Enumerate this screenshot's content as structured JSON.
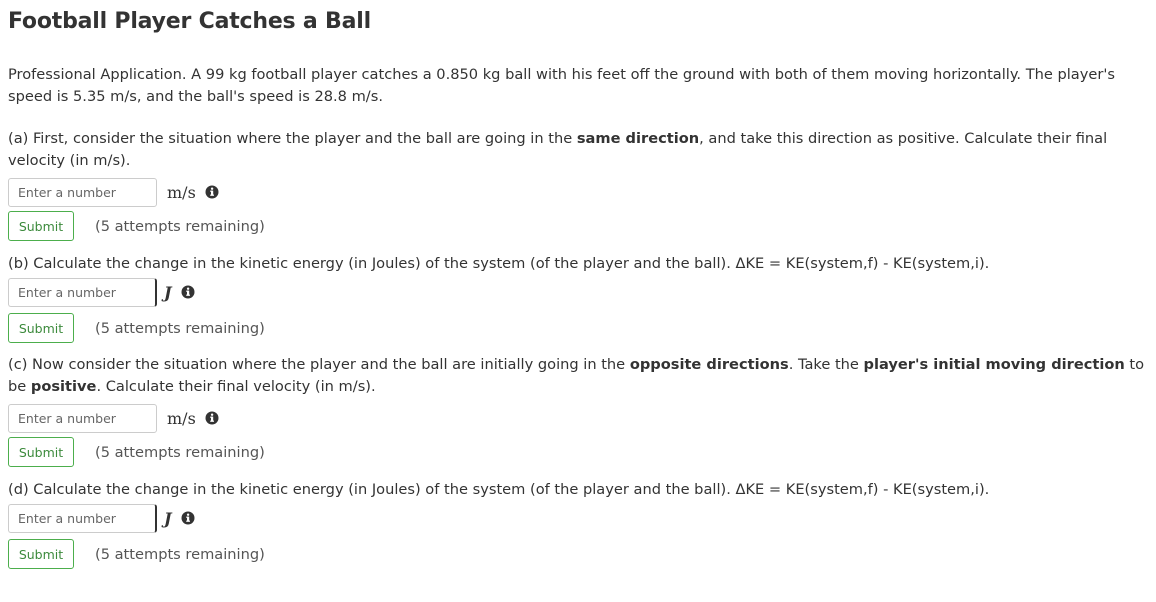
{
  "title": "Football Player Catches a Ball",
  "intro": "Professional Application. A 99 kg football player catches a 0.850 kg ball with his feet off the ground with both of them moving horizontally. The player's speed is 5.35 m/s, and the ball's speed is 28.8 m/s.",
  "parts": [
    {
      "text_segments": [
        "(a) First, consider the situation where the player and the ball are going in the ",
        "same direction",
        ", and take this direction as positive. Calculate their final velocity (in m/s)."
      ],
      "placeholder": "Enter a number",
      "unit": "m/s",
      "submit_label": "Submit",
      "attempts": "(5 attempts remaining)"
    },
    {
      "text": "(b) Calculate the change in the kinetic energy (in Joules) of the system (of the player and the ball). ΔKE = KE(system,f) - KE(system,i).",
      "placeholder": "Enter a number",
      "unit": "J",
      "submit_label": "Submit",
      "attempts": "(5 attempts remaining)"
    },
    {
      "text_segments": [
        "(c) Now consider the situation where the player and the ball are initially going in the ",
        "opposite directions",
        ". Take the ",
        "player's initial moving direction",
        " to be ",
        "positive",
        ". Calculate their final velocity (in m/s)."
      ],
      "placeholder": "Enter a number",
      "unit": "m/s",
      "submit_label": "Submit",
      "attempts": "(5 attempts remaining)"
    },
    {
      "text": "(d) Calculate the change in the kinetic energy (in Joules) of the system (of the player and the ball). ΔKE = KE(system,f) - KE(system,i).",
      "placeholder": "Enter a number",
      "unit": "J",
      "submit_label": "Submit",
      "attempts": "(5 attempts remaining)"
    }
  ],
  "icons": {
    "info": "info-circle-icon"
  },
  "colors": {
    "submit_border": "#4cae4c",
    "submit_text": "#3c8a3c",
    "text": "#333333"
  }
}
